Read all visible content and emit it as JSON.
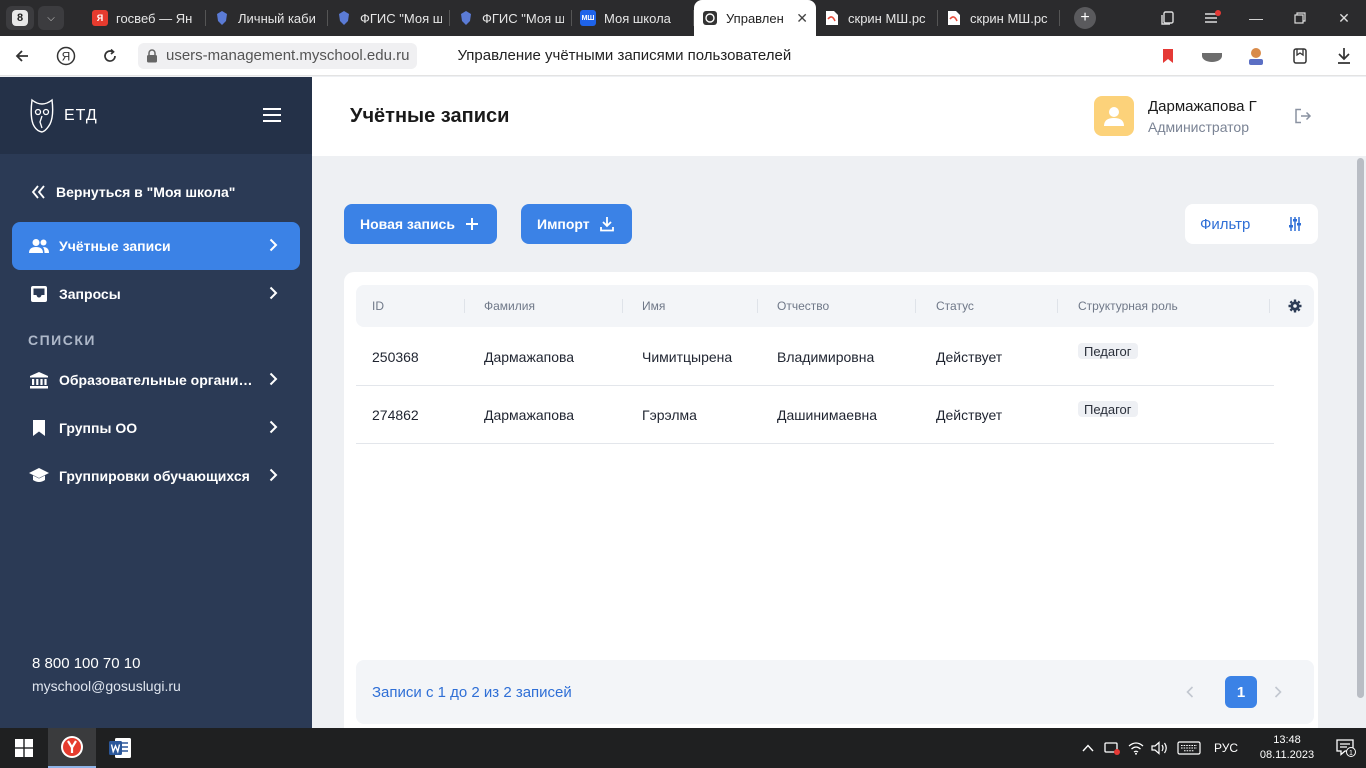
{
  "browser": {
    "tab_count": "8",
    "tabs": [
      {
        "label": "госвеб — Ян",
        "favicon_color": "#e63b2e",
        "favicon_text": "Я"
      },
      {
        "label": "Личный каби",
        "favicon_color": "#3b5cc9",
        "favicon_text": ""
      },
      {
        "label": "ФГИС \"Моя ш",
        "favicon_color": "#3b5cc9",
        "favicon_text": ""
      },
      {
        "label": "ФГИС \"Моя ш",
        "favicon_color": "#3b5cc9",
        "favicon_text": ""
      },
      {
        "label": "Моя школа",
        "favicon_color": "#1e63e9",
        "favicon_text": "МШ"
      },
      {
        "label": "Управлен",
        "favicon_color": "#333333",
        "favicon_text": "",
        "active": true
      },
      {
        "label": "скрин МШ.рс",
        "favicon_color": "#e74c3c",
        "favicon_text": ""
      },
      {
        "label": "скрин МШ.рс",
        "favicon_color": "#e74c3c",
        "favicon_text": ""
      }
    ],
    "url": "users-management.myschool.edu.ru",
    "page_title": "Управление учётными записями пользователей"
  },
  "sidebar": {
    "logo_text": "ЕТД",
    "back_link": "Вернуться в \"Моя школа\"",
    "items": [
      {
        "label": "Учётные записи",
        "icon": "users-icon",
        "active": true
      },
      {
        "label": "Запросы",
        "icon": "inbox-icon",
        "active": false
      }
    ],
    "section_title": "СПИСКИ",
    "list_items": [
      {
        "label": "Образовательные организации",
        "icon": "institution-icon"
      },
      {
        "label": "Группы ОО",
        "icon": "bookmark-icon"
      },
      {
        "label": "Группировки обучающихся",
        "icon": "graduation-cap-icon"
      }
    ],
    "phone": "8 800 100 70 10",
    "email": "myschool@gosuslugi.ru"
  },
  "header": {
    "title": "Учётные записи",
    "user_name": "Дармажапова Г",
    "user_role": "Администратор"
  },
  "toolbar": {
    "new_record": "Новая запись",
    "import": "Импорт",
    "filter": "Фильтр"
  },
  "table": {
    "columns": [
      "ID",
      "Фамилия",
      "Имя",
      "Отчество",
      "Статус",
      "Структурная роль"
    ],
    "rows": [
      {
        "id": "250368",
        "last_name": "Дармажапова",
        "first_name": "Чимитцырена",
        "patronymic": "Владимировна",
        "status": "Действует",
        "role": "Педагог"
      },
      {
        "id": "274862",
        "last_name": "Дармажапова",
        "first_name": "Гэрэлма",
        "patronymic": "Дашинимаевна",
        "status": "Действует",
        "role": "Педагог"
      }
    ]
  },
  "pagination": {
    "summary": "Записи с 1 до 2 из 2 записей",
    "current_page": "1"
  },
  "taskbar": {
    "language": "РУС",
    "time": "13:48",
    "date": "08.11.2023",
    "notification_count": "1"
  },
  "colors": {
    "accent": "#3b82e6",
    "sidebar_bg": "#2b3a55",
    "sidebar_header_bg": "#243148",
    "link": "#2f6fd6",
    "avatar_bg": "#fcd27a"
  }
}
